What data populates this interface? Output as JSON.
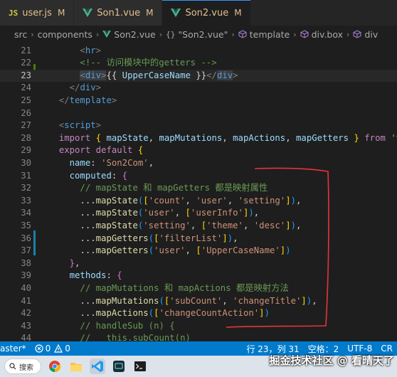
{
  "tabs": [
    {
      "icon": "js-icon",
      "icon_text": "JS",
      "label": "user.js",
      "modified": "M",
      "active": false
    },
    {
      "icon": "vue-icon",
      "label": "Son1.vue",
      "modified": "M",
      "active": false
    },
    {
      "icon": "vue-icon",
      "label": "Son2.vue",
      "modified": "M",
      "active": true
    }
  ],
  "breadcrumb": {
    "items": [
      "src",
      "components",
      "Son2.vue",
      "\"Son2.vue\"",
      "template",
      "div.box",
      "div"
    ],
    "braces": "{}"
  },
  "editor": {
    "current_line": 23,
    "lines": [
      {
        "n": "21",
        "tokens": [
          [
            "t-plain",
            "      "
          ],
          [
            "t-brk",
            "<"
          ],
          [
            "t-tag",
            "hr"
          ],
          [
            "t-brk",
            ">"
          ]
        ]
      },
      {
        "n": "22",
        "tokens": [
          [
            "t-plain",
            "      "
          ],
          [
            "t-cmt",
            "<!-- 访问模块中的getters -->"
          ]
        ]
      },
      {
        "n": "23",
        "tokens": [
          [
            "t-plain",
            "      "
          ],
          [
            "t-brk hl-tag",
            "<"
          ],
          [
            "t-tag hl-tag",
            "div"
          ],
          [
            "t-brk hl-tag",
            ">"
          ],
          [
            "t-plain",
            "{{ "
          ],
          [
            "t-var",
            "UpperCaseName"
          ],
          [
            "t-plain",
            " }}"
          ],
          [
            "t-brk",
            "</"
          ],
          [
            "t-tag hl-tag",
            "div"
          ],
          [
            "t-brk",
            ">"
          ]
        ]
      },
      {
        "n": "24",
        "tokens": [
          [
            "t-plain",
            "    "
          ],
          [
            "t-brk",
            "</"
          ],
          [
            "t-tag",
            "div"
          ],
          [
            "t-brk",
            ">"
          ]
        ]
      },
      {
        "n": "25",
        "tokens": [
          [
            "t-plain",
            "  "
          ],
          [
            "t-brk",
            "</"
          ],
          [
            "t-tag",
            "template"
          ],
          [
            "t-brk",
            ">"
          ]
        ]
      },
      {
        "n": "26",
        "tokens": []
      },
      {
        "n": "27",
        "tokens": [
          [
            "t-plain",
            "  "
          ],
          [
            "t-brk",
            "<"
          ],
          [
            "t-tag",
            "script"
          ],
          [
            "t-brk",
            ">"
          ]
        ]
      },
      {
        "n": "28",
        "tokens": [
          [
            "t-plain",
            "  "
          ],
          [
            "t-kw",
            "import"
          ],
          [
            "t-plain",
            " "
          ],
          [
            "t-b1",
            "{"
          ],
          [
            "t-plain",
            " "
          ],
          [
            "t-var",
            "mapState"
          ],
          [
            "t-plain",
            ", "
          ],
          [
            "t-var",
            "mapMutations"
          ],
          [
            "t-plain",
            ", "
          ],
          [
            "t-var",
            "mapActions"
          ],
          [
            "t-plain",
            ", "
          ],
          [
            "t-var",
            "mapGetters"
          ],
          [
            "t-plain",
            " "
          ],
          [
            "t-b1",
            "}"
          ],
          [
            "t-plain",
            " "
          ],
          [
            "t-kw",
            "from"
          ],
          [
            "t-plain",
            " "
          ],
          [
            "t-str",
            "'vuex'"
          ]
        ]
      },
      {
        "n": "29",
        "tokens": [
          [
            "t-plain",
            "  "
          ],
          [
            "t-kw",
            "export"
          ],
          [
            "t-plain",
            " "
          ],
          [
            "t-kw",
            "default"
          ],
          [
            "t-plain",
            " "
          ],
          [
            "t-b1",
            "{"
          ]
        ]
      },
      {
        "n": "30",
        "tokens": [
          [
            "t-plain",
            "    "
          ],
          [
            "t-var",
            "name"
          ],
          [
            "t-plain",
            ": "
          ],
          [
            "t-str",
            "'Son2Com'"
          ],
          [
            "t-plain",
            ","
          ]
        ]
      },
      {
        "n": "31",
        "tokens": [
          [
            "t-plain",
            "    "
          ],
          [
            "t-var",
            "computed"
          ],
          [
            "t-plain",
            ": "
          ],
          [
            "t-b2",
            "{"
          ]
        ]
      },
      {
        "n": "32",
        "tokens": [
          [
            "t-plain",
            "      "
          ],
          [
            "t-cmt",
            "// mapState 和 mapGetters 都是映射属性"
          ]
        ]
      },
      {
        "n": "33",
        "tokens": [
          [
            "t-plain",
            "      ..."
          ],
          [
            "t-fn",
            "mapState"
          ],
          [
            "t-b3",
            "("
          ],
          [
            "t-b1",
            "["
          ],
          [
            "t-str",
            "'count'"
          ],
          [
            "t-plain",
            ", "
          ],
          [
            "t-str",
            "'user'"
          ],
          [
            "t-plain",
            ", "
          ],
          [
            "t-str",
            "'setting'"
          ],
          [
            "t-b1",
            "]"
          ],
          [
            "t-b3",
            ")"
          ],
          [
            "t-plain",
            ","
          ]
        ]
      },
      {
        "n": "34",
        "tokens": [
          [
            "t-plain",
            "      ..."
          ],
          [
            "t-fn",
            "mapState"
          ],
          [
            "t-b3",
            "("
          ],
          [
            "t-str",
            "'user'"
          ],
          [
            "t-plain",
            ", "
          ],
          [
            "t-b1",
            "["
          ],
          [
            "t-str",
            "'userInfo'"
          ],
          [
            "t-b1",
            "]"
          ],
          [
            "t-b3",
            ")"
          ],
          [
            "t-plain",
            ","
          ]
        ]
      },
      {
        "n": "35",
        "tokens": [
          [
            "t-plain",
            "      ..."
          ],
          [
            "t-fn",
            "mapState"
          ],
          [
            "t-b3",
            "("
          ],
          [
            "t-str",
            "'setting'"
          ],
          [
            "t-plain",
            ", "
          ],
          [
            "t-b1",
            "["
          ],
          [
            "t-str",
            "'theme'"
          ],
          [
            "t-plain",
            ", "
          ],
          [
            "t-str",
            "'desc'"
          ],
          [
            "t-b1",
            "]"
          ],
          [
            "t-b3",
            ")"
          ],
          [
            "t-plain",
            ","
          ]
        ]
      },
      {
        "n": "36",
        "tokens": [
          [
            "t-plain",
            "      ..."
          ],
          [
            "t-fn",
            "mapGetters"
          ],
          [
            "t-b3",
            "("
          ],
          [
            "t-b1",
            "["
          ],
          [
            "t-str",
            "'filterList'"
          ],
          [
            "t-b1",
            "]"
          ],
          [
            "t-b3",
            ")"
          ],
          [
            "t-plain",
            ","
          ]
        ]
      },
      {
        "n": "37",
        "tokens": [
          [
            "t-plain",
            "      ..."
          ],
          [
            "t-fn",
            "mapGetters"
          ],
          [
            "t-b3",
            "("
          ],
          [
            "t-str",
            "'user'"
          ],
          [
            "t-plain",
            ", "
          ],
          [
            "t-b1",
            "["
          ],
          [
            "t-str",
            "'UpperCaseName'"
          ],
          [
            "t-b1",
            "]"
          ],
          [
            "t-b3",
            ")"
          ]
        ]
      },
      {
        "n": "38",
        "tokens": [
          [
            "t-plain",
            "    "
          ],
          [
            "t-b2",
            "}"
          ],
          [
            "t-plain",
            ","
          ]
        ]
      },
      {
        "n": "39",
        "tokens": [
          [
            "t-plain",
            "    "
          ],
          [
            "t-var",
            "methods"
          ],
          [
            "t-plain",
            ": "
          ],
          [
            "t-b2",
            "{"
          ]
        ]
      },
      {
        "n": "40",
        "tokens": [
          [
            "t-plain",
            "      "
          ],
          [
            "t-cmt",
            "// mapMutations 和 mapActions 都是映射方法"
          ]
        ]
      },
      {
        "n": "41",
        "tokens": [
          [
            "t-plain",
            "      ..."
          ],
          [
            "t-fn",
            "mapMutations"
          ],
          [
            "t-b3",
            "("
          ],
          [
            "t-b1",
            "["
          ],
          [
            "t-str",
            "'subCount'"
          ],
          [
            "t-plain",
            ", "
          ],
          [
            "t-str",
            "'changeTitle'"
          ],
          [
            "t-b1",
            "]"
          ],
          [
            "t-b3",
            ")"
          ],
          [
            "t-plain",
            ","
          ]
        ]
      },
      {
        "n": "42",
        "tokens": [
          [
            "t-plain",
            "      ..."
          ],
          [
            "t-fn",
            "mapActions"
          ],
          [
            "t-b3",
            "("
          ],
          [
            "t-b1",
            "["
          ],
          [
            "t-str",
            "'changeCountAction'"
          ],
          [
            "t-b1",
            "]"
          ],
          [
            "t-b3",
            ")"
          ]
        ]
      },
      {
        "n": "43",
        "tokens": [
          [
            "t-plain",
            "      "
          ],
          [
            "t-cmt",
            "// handleSub (n) {"
          ]
        ]
      },
      {
        "n": "44",
        "tokens": [
          [
            "t-plain",
            "      "
          ],
          [
            "t-cmt",
            "//   this.subCount(n)"
          ]
        ]
      }
    ]
  },
  "statusbar": {
    "branch": "aster*",
    "errors": "0",
    "warnings": "0",
    "position": "行 23，列 31",
    "spaces": "空格：2",
    "encoding": "UTF-8",
    "eol": "CR"
  },
  "taskbar": {
    "search_label": "搜索"
  },
  "watermark": "掘金技术社区 @ 看晴天了",
  "colors": {
    "accent": "#007acc",
    "annotation": "#e8333a"
  }
}
